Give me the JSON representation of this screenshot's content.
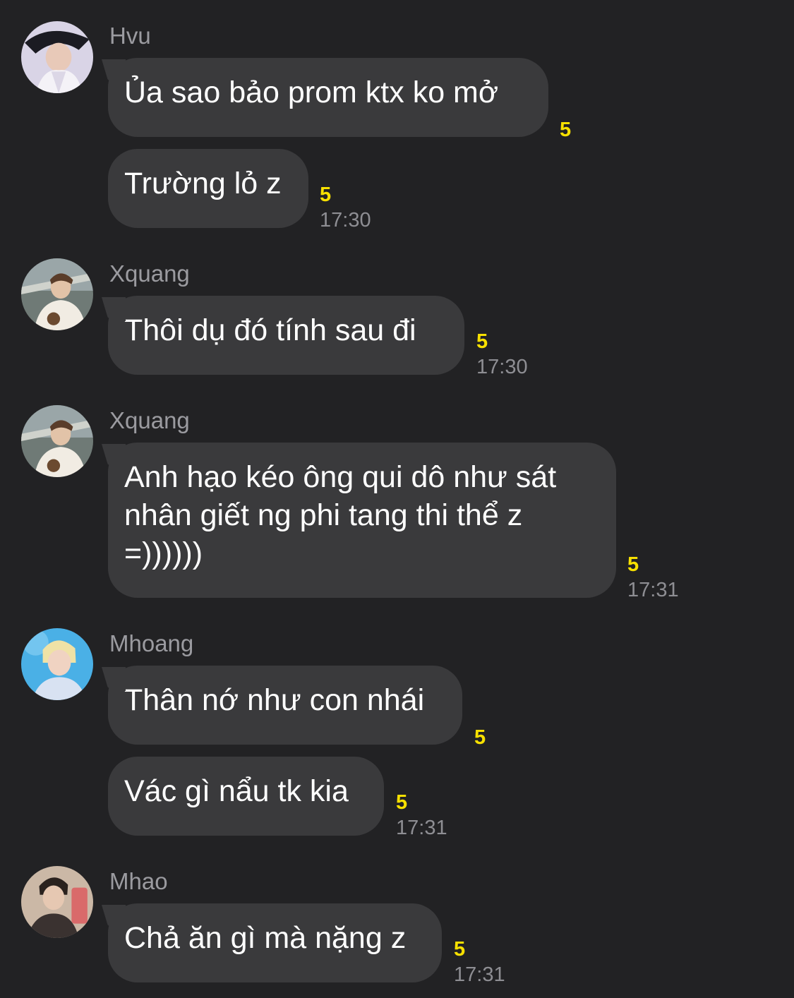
{
  "messages": [
    {
      "sender": "Hvu",
      "text": "Ủa sao bảo prom ktx ko mở",
      "count": "5",
      "time": ""
    },
    {
      "sender": "",
      "text": "Trường lỏ z",
      "count": "5",
      "time": "17:30"
    },
    {
      "sender": "Xquang",
      "text": "Thôi dụ đó tính sau đi",
      "count": "5",
      "time": "17:30"
    },
    {
      "sender": "Xquang",
      "text": "Anh hạo kéo ông qui dô như sát\nnhân giết ng phi tang thi thể z\n=))))))",
      "count": "5",
      "time": "17:31"
    },
    {
      "sender": "Mhoang",
      "text": "Thân nớ như con nhái",
      "count": "5",
      "time": ""
    },
    {
      "sender": "",
      "text": "Vác gì nẩu tk kia",
      "count": "5",
      "time": "17:31"
    },
    {
      "sender": "Mhao",
      "text": "Chả ăn gì mà nặng z",
      "count": "5",
      "time": "17:31"
    }
  ],
  "colors": {
    "background": "#222224",
    "bubble": "#3a3a3c",
    "sender": "#9b9ba0",
    "count": "#f7e000",
    "time": "#8e8e93"
  }
}
